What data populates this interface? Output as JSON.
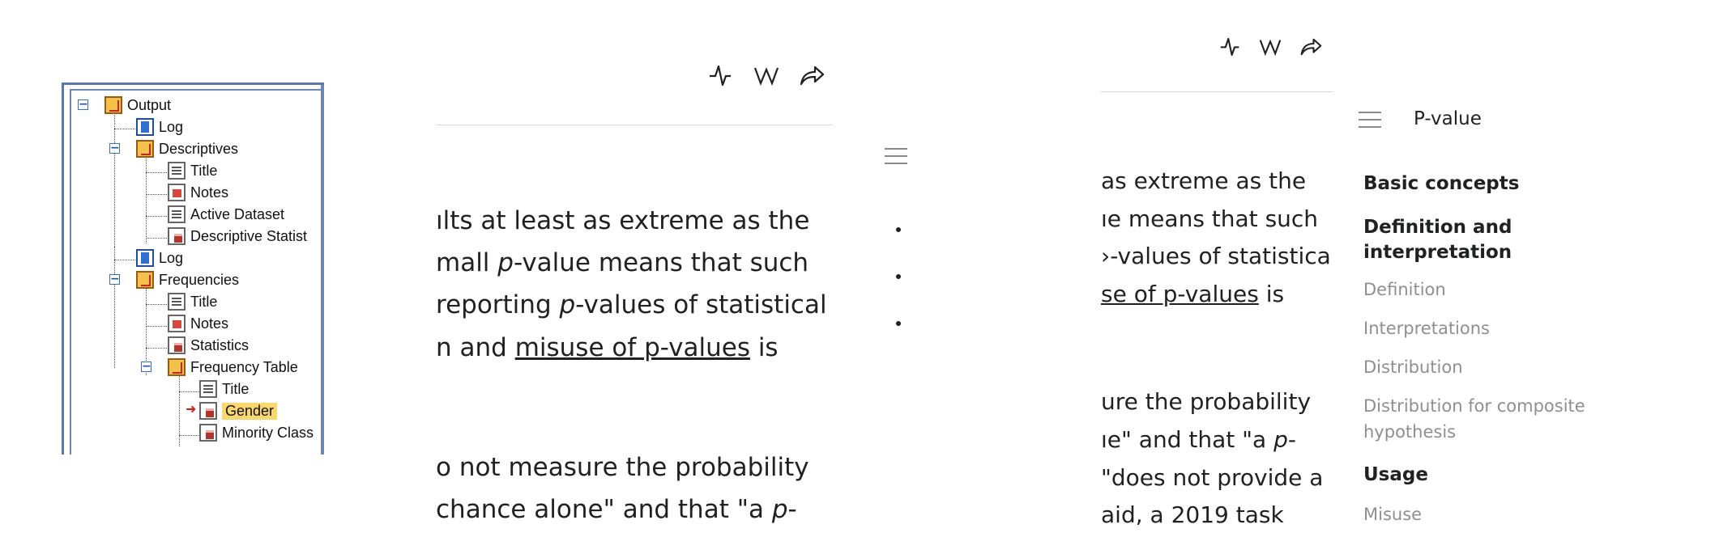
{
  "spss_tree": {
    "nodes": [
      {
        "label": "Output",
        "icon": "output-book-icon"
      },
      {
        "label": "Log",
        "icon": "log-icon"
      },
      {
        "label": "Descriptives",
        "icon": "output-book-icon"
      },
      {
        "label": "Title",
        "icon": "title-page-icon"
      },
      {
        "label": "Notes",
        "icon": "notes-icon"
      },
      {
        "label": "Active Dataset",
        "icon": "dataset-page-icon"
      },
      {
        "label": "Descriptive Statist",
        "icon": "table-icon"
      },
      {
        "label": "Log",
        "icon": "log-icon"
      },
      {
        "label": "Frequencies",
        "icon": "output-book-icon"
      },
      {
        "label": "Title",
        "icon": "title-page-icon"
      },
      {
        "label": "Notes",
        "icon": "notes-icon"
      },
      {
        "label": "Statistics",
        "icon": "table-icon"
      },
      {
        "label": "Frequency Table",
        "icon": "output-book-icon"
      },
      {
        "label": "Title",
        "icon": "title-page-icon"
      },
      {
        "label": "Gender",
        "icon": "table-icon",
        "selected": true
      },
      {
        "label": "Minority Class",
        "icon": "table-icon"
      }
    ],
    "selected_color": "#f9d76d"
  },
  "article_left": {
    "toolbar_icons": [
      "activity-icon",
      "wikipedia-icon",
      "share-icon"
    ],
    "lines": {
      "l1": "ılts at least as extreme as the",
      "l2_a": "mall ",
      "l2_p": "p",
      "l2_b": "-value means that such",
      "l3_a": "reporting ",
      "l3_p": "p",
      "l3_b": "-values of statistical",
      "l4_a": "n and ",
      "l4_link": "misuse of p-values",
      "l4_b": " is",
      "l5": "o not measure the probability",
      "l6_a": "chance alone\" and that \"a ",
      "l6_p": "p",
      "l6_b": "-"
    }
  },
  "article_right": {
    "toolbar_icons": [
      "activity-icon",
      "wikipedia-icon",
      "share-icon"
    ],
    "lines": {
      "l1": "as extreme as the",
      "l2": "ıe means that such",
      "l3": "›-values of statistical",
      "l4_link": "se of p-values",
      "l4_b": " is",
      "l5": "ure the probability",
      "l6_a": "ıe\" and that \"a ",
      "l6_p": "p",
      "l6_b": "-",
      "l7": "\"does not provide a",
      "l8": "aid, a 2019 task"
    }
  },
  "toc": {
    "title": "P-value",
    "sections": [
      {
        "label": "Basic concepts",
        "level": 1
      },
      {
        "label": "Definition and interpretation",
        "level": 1
      },
      {
        "label": "Definition",
        "level": 2
      },
      {
        "label": "Interpretations",
        "level": 2
      },
      {
        "label": "Distribution",
        "level": 2
      },
      {
        "label": "Distribution for composite hypothesis",
        "level": 2
      },
      {
        "label": "Usage",
        "level": 1
      },
      {
        "label": "Misuse",
        "level": 2
      }
    ],
    "toc_h2": "Definition and",
    "toc_h2b": "interpretation",
    "toc_sub4a": "Distribution for composite",
    "toc_sub4b": "hypothesis"
  }
}
